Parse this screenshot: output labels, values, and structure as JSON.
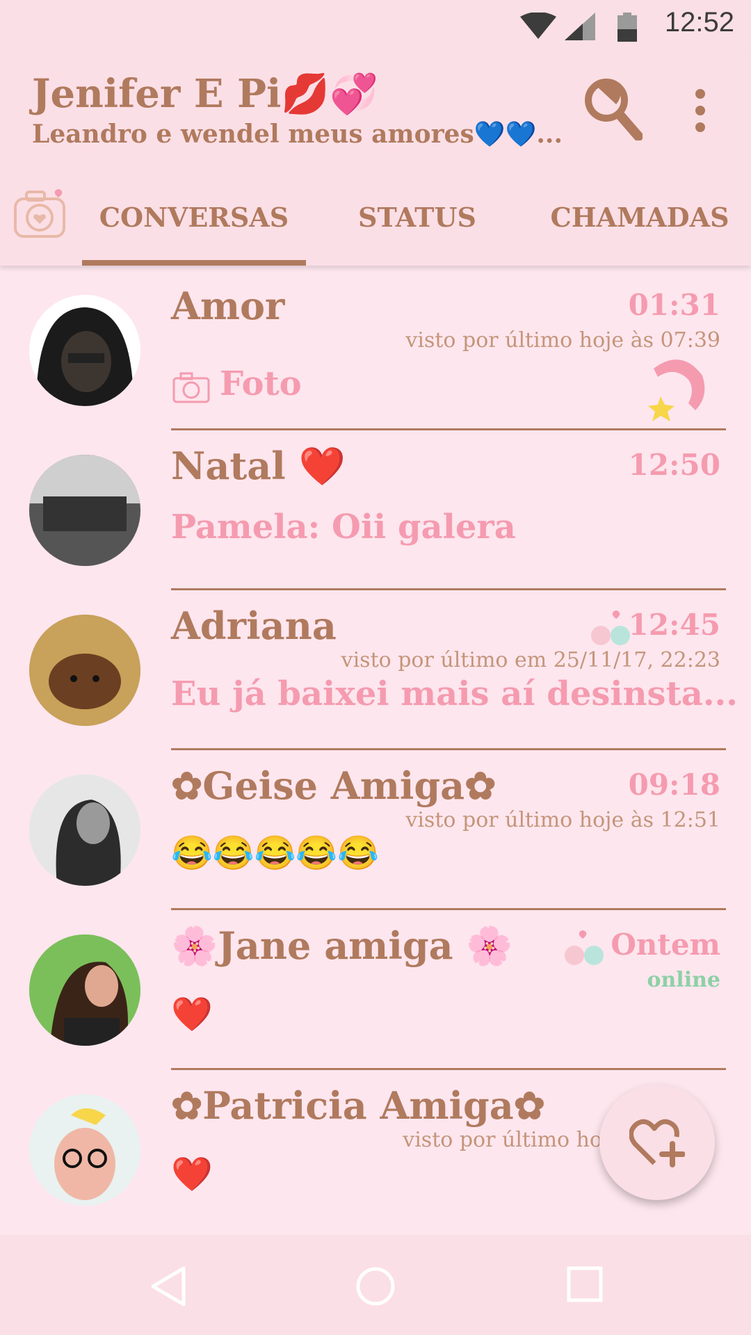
{
  "status_bar": {
    "time": "12:52"
  },
  "header": {
    "title": "Jenifer E Pi💋💞",
    "subtitle": "Leandro e wendel meus amores💙💙..."
  },
  "tabs": [
    {
      "label": "CONVERSAS",
      "active": true
    },
    {
      "label": "STATUS",
      "active": false
    },
    {
      "label": "CHAMADAS",
      "active": false
    }
  ],
  "chats": [
    {
      "name": "Amor",
      "time": "01:31",
      "last_seen": "visto por último hoje às 07:39",
      "preview": "Foto",
      "preview_icon": "camera-icon"
    },
    {
      "name": "Natal ❤️",
      "time": "12:50",
      "last_seen": "",
      "preview": "Pamela: Oii galera"
    },
    {
      "name": "Adriana",
      "time": "12:45",
      "last_seen": "visto por último em 25/11/17, 22:23",
      "preview": "Eu já baixei mais aí desinsta..."
    },
    {
      "name": "✿Geise Amiga✿",
      "time": "09:18",
      "last_seen": "visto por último hoje às 12:51",
      "preview": "😂😂😂😂😂"
    },
    {
      "name": "🌸Jane amiga 🌸",
      "time": "Ontem",
      "last_seen": "online",
      "preview": "❤️"
    },
    {
      "name": "✿Patricia Amiga✿",
      "time": "",
      "last_seen": "visto por último ho",
      "preview": "❤️"
    }
  ],
  "colors": {
    "accent": "#b07a5e",
    "pink": "#f59bb0",
    "background": "#fde6ee",
    "bar": "#fbdfe6"
  }
}
